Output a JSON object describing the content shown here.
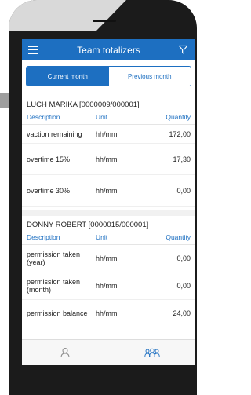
{
  "header": {
    "title": "Team totalizers",
    "menu_icon": "hamburger-menu-icon",
    "filter_icon": "filter-icon"
  },
  "tabs": [
    {
      "label": "Current month",
      "active": true
    },
    {
      "label": "Previous month",
      "active": false
    }
  ],
  "columns": {
    "description": "Description",
    "unit": "Unit",
    "quantity": "Quantity"
  },
  "employees": [
    {
      "name": "LUCH MARIKA [0000009/000001]",
      "rows": [
        {
          "description": "vaction remaining",
          "unit": "hh/mm",
          "quantity": "172,00"
        },
        {
          "description": "overtime 15%",
          "unit": "hh/mm",
          "quantity": "17,30"
        },
        {
          "description": "overtime 30%",
          "unit": "hh/mm",
          "quantity": "0,00"
        }
      ]
    },
    {
      "name": "DONNY ROBERT [0000015/000001]",
      "rows": [
        {
          "description": "permission taken (year)",
          "unit": "hh/mm",
          "quantity": "0,00"
        },
        {
          "description": "permission taken (month)",
          "unit": "hh/mm",
          "quantity": "0,00"
        },
        {
          "description": "permission balance",
          "unit": "hh/mm",
          "quantity": "24,00"
        }
      ]
    }
  ],
  "bottom_nav": [
    {
      "icon": "user-icon",
      "active": false
    },
    {
      "icon": "team-icon",
      "active": true
    }
  ],
  "colors": {
    "accent": "#1d6fc1",
    "phone_body": "#1b1b1b"
  }
}
